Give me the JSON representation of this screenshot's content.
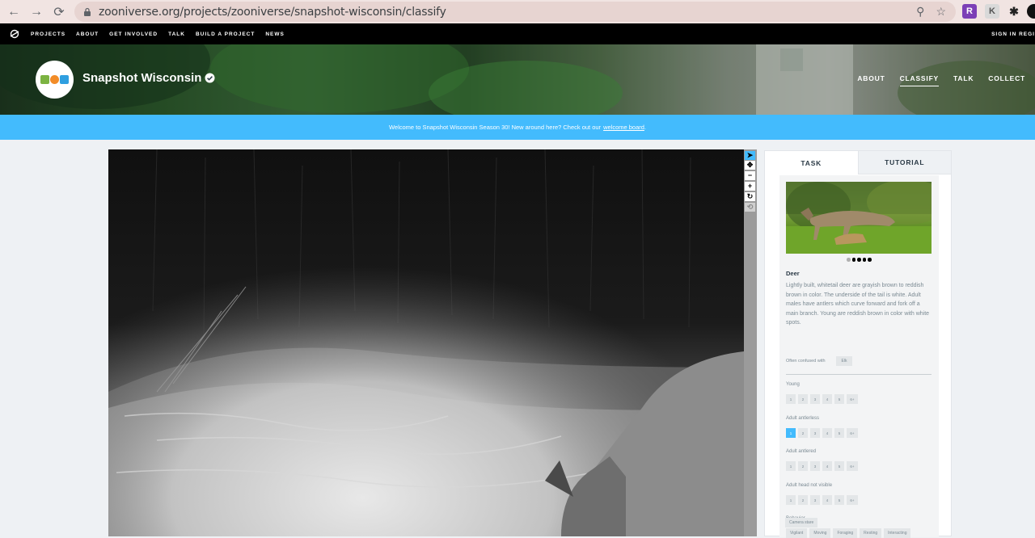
{
  "browser": {
    "url": "zooniverse.org/projects/zooniverse/snapshot-wisconsin/classify"
  },
  "zoo_nav": {
    "links": [
      "PROJECTS",
      "ABOUT",
      "GET INVOLVED",
      "TALK",
      "BUILD A PROJECT",
      "NEWS"
    ],
    "right_text": "SIGN IN  REGI"
  },
  "project": {
    "title": "Snapshot Wisconsin",
    "nav": [
      "ABOUT",
      "CLASSIFY",
      "TALK",
      "COLLECT"
    ]
  },
  "announcement": {
    "text": "Welcome to Snapshot Wisconsin Season 30! New around here? Check out our",
    "link": "welcome board",
    "suffix": "."
  },
  "tabs": {
    "task": "TASK",
    "tutorial": "TUTORIAL"
  },
  "species": {
    "name": "Deer",
    "description": "Lightly built, whitetail deer are grayish brown to reddish brown in color. The underside of the tail is white. Adult males have antlers which curve forward and fork off a main branch. Young are reddish brown in color with white spots.",
    "confused_label": "Often confused with",
    "confused_with": "Elk",
    "photo_count": 5,
    "selected_photo_index": 0
  },
  "questions": [
    {
      "label": "Young",
      "options": [
        "1",
        "2",
        "3",
        "4",
        "5",
        "6+"
      ],
      "selected": null
    },
    {
      "label": "Adult antlerless",
      "options": [
        "1",
        "2",
        "3",
        "4",
        "5",
        "6+"
      ],
      "selected": "1"
    },
    {
      "label": "Adult antlered",
      "options": [
        "1",
        "2",
        "3",
        "4",
        "5",
        "6+"
      ],
      "selected": null
    },
    {
      "label": "Adult head not visible",
      "options": [
        "1",
        "2",
        "3",
        "4",
        "5",
        "6+"
      ],
      "selected": null
    }
  ],
  "behavior": {
    "label": "Behavior",
    "options_row1": [
      "Vigilant",
      "Moving",
      "Foraging",
      "Resting",
      "Interacting"
    ],
    "options_row2": [
      "Camera stare"
    ]
  },
  "colors": {
    "accent": "#43bbfd",
    "nav_bg": "#000000"
  }
}
